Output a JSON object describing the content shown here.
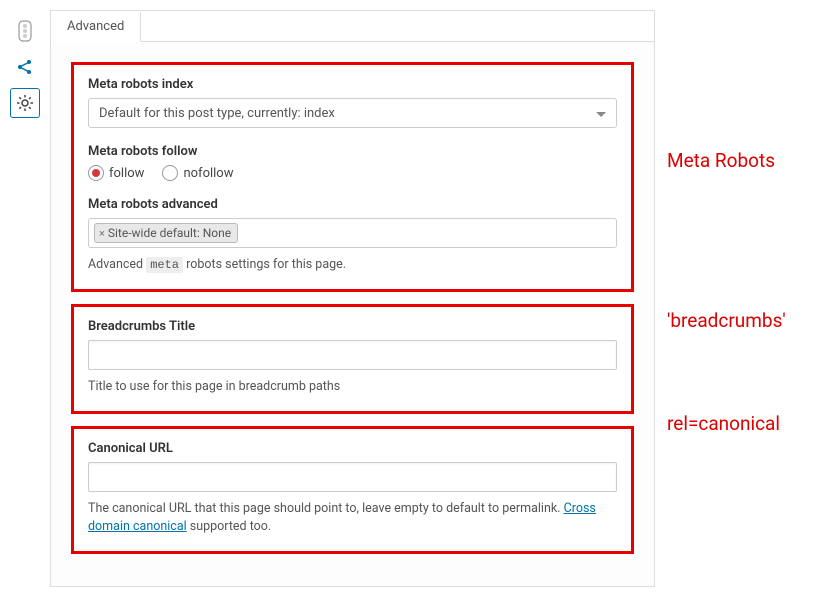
{
  "tab": {
    "label": "Advanced"
  },
  "sidebar": {
    "icons": [
      "traffic-light",
      "share",
      "gear"
    ]
  },
  "metaRobots": {
    "indexLabel": "Meta robots index",
    "indexValue": "Default for this post type, currently: index",
    "followLabel": "Meta robots follow",
    "followOption": "follow",
    "nofollowOption": "nofollow",
    "advancedLabel": "Meta robots advanced",
    "advancedTag": "Site-wide default: None",
    "advancedHelpPrefix": "Advanced ",
    "advancedHelpCode": "meta",
    "advancedHelpSuffix": " robots settings for this page."
  },
  "breadcrumbs": {
    "label": "Breadcrumbs Title",
    "help": "Title to use for this page in breadcrumb paths"
  },
  "canonical": {
    "label": "Canonical URL",
    "helpPrefix": "The canonical URL that this page should point to, leave empty to default to permalink. ",
    "helpLink": "Cross domain canonical",
    "helpSuffix": " supported too."
  },
  "annotations": {
    "metaRobots": "Meta Robots",
    "breadcrumbs": "'breadcrumbs'",
    "canonical": "rel=canonical"
  }
}
